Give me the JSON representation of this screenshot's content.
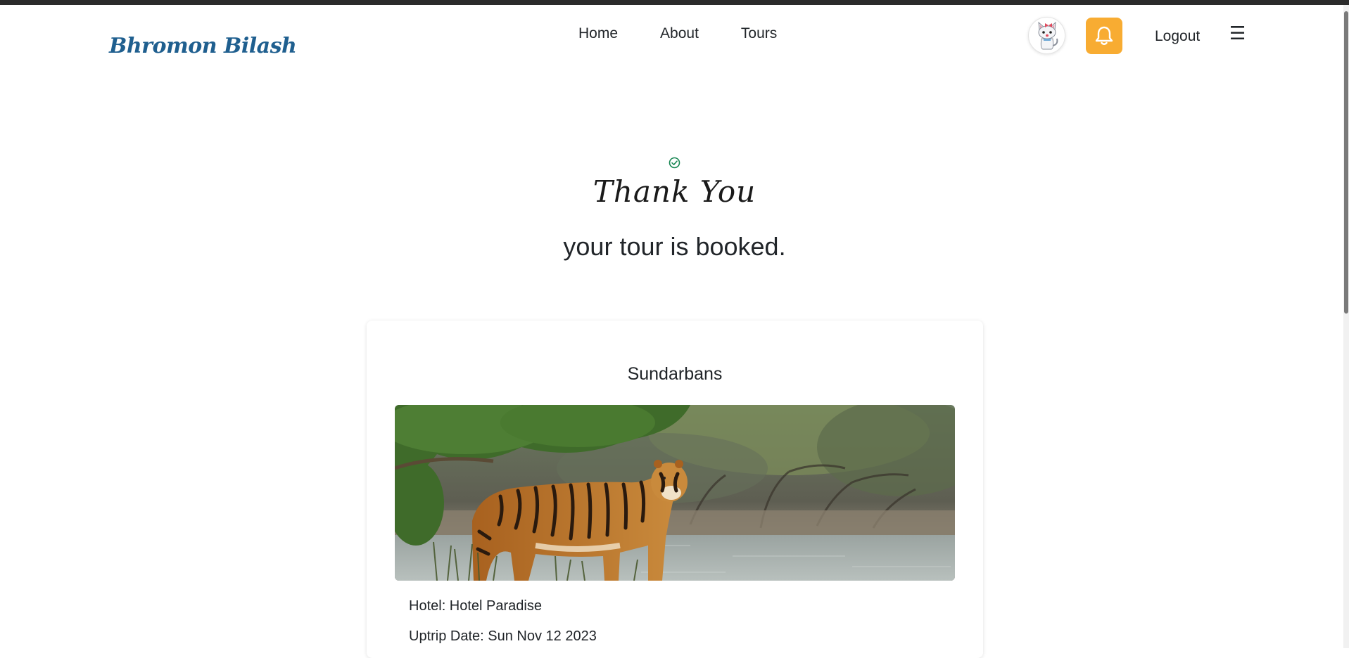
{
  "brand": {
    "logo_text": "Bhromon Bilash",
    "logo_icon": "globe-luggage-icon",
    "logo_color": "#1f5f8f",
    "logo_accent": "#c9a82a"
  },
  "nav": {
    "links": [
      {
        "label": "Home"
      },
      {
        "label": "About"
      },
      {
        "label": "Tours"
      }
    ],
    "avatar_icon": "cat-avatar-icon",
    "notification_icon": "bell-icon",
    "notification_color": "#f8ac32",
    "logout_label": "Logout",
    "menu_glyph": "☰"
  },
  "confirmation": {
    "status_icon": "check-circle-icon",
    "status_color": "#198754",
    "heading": "Thank You",
    "message": "your tour is booked."
  },
  "booking": {
    "destination": "Sundarbans",
    "image_description_icon": "tiger-photo",
    "hotel_line": "Hotel: Hotel Paradise",
    "date_line": "Uptrip Date: Sun Nov 12 2023"
  }
}
